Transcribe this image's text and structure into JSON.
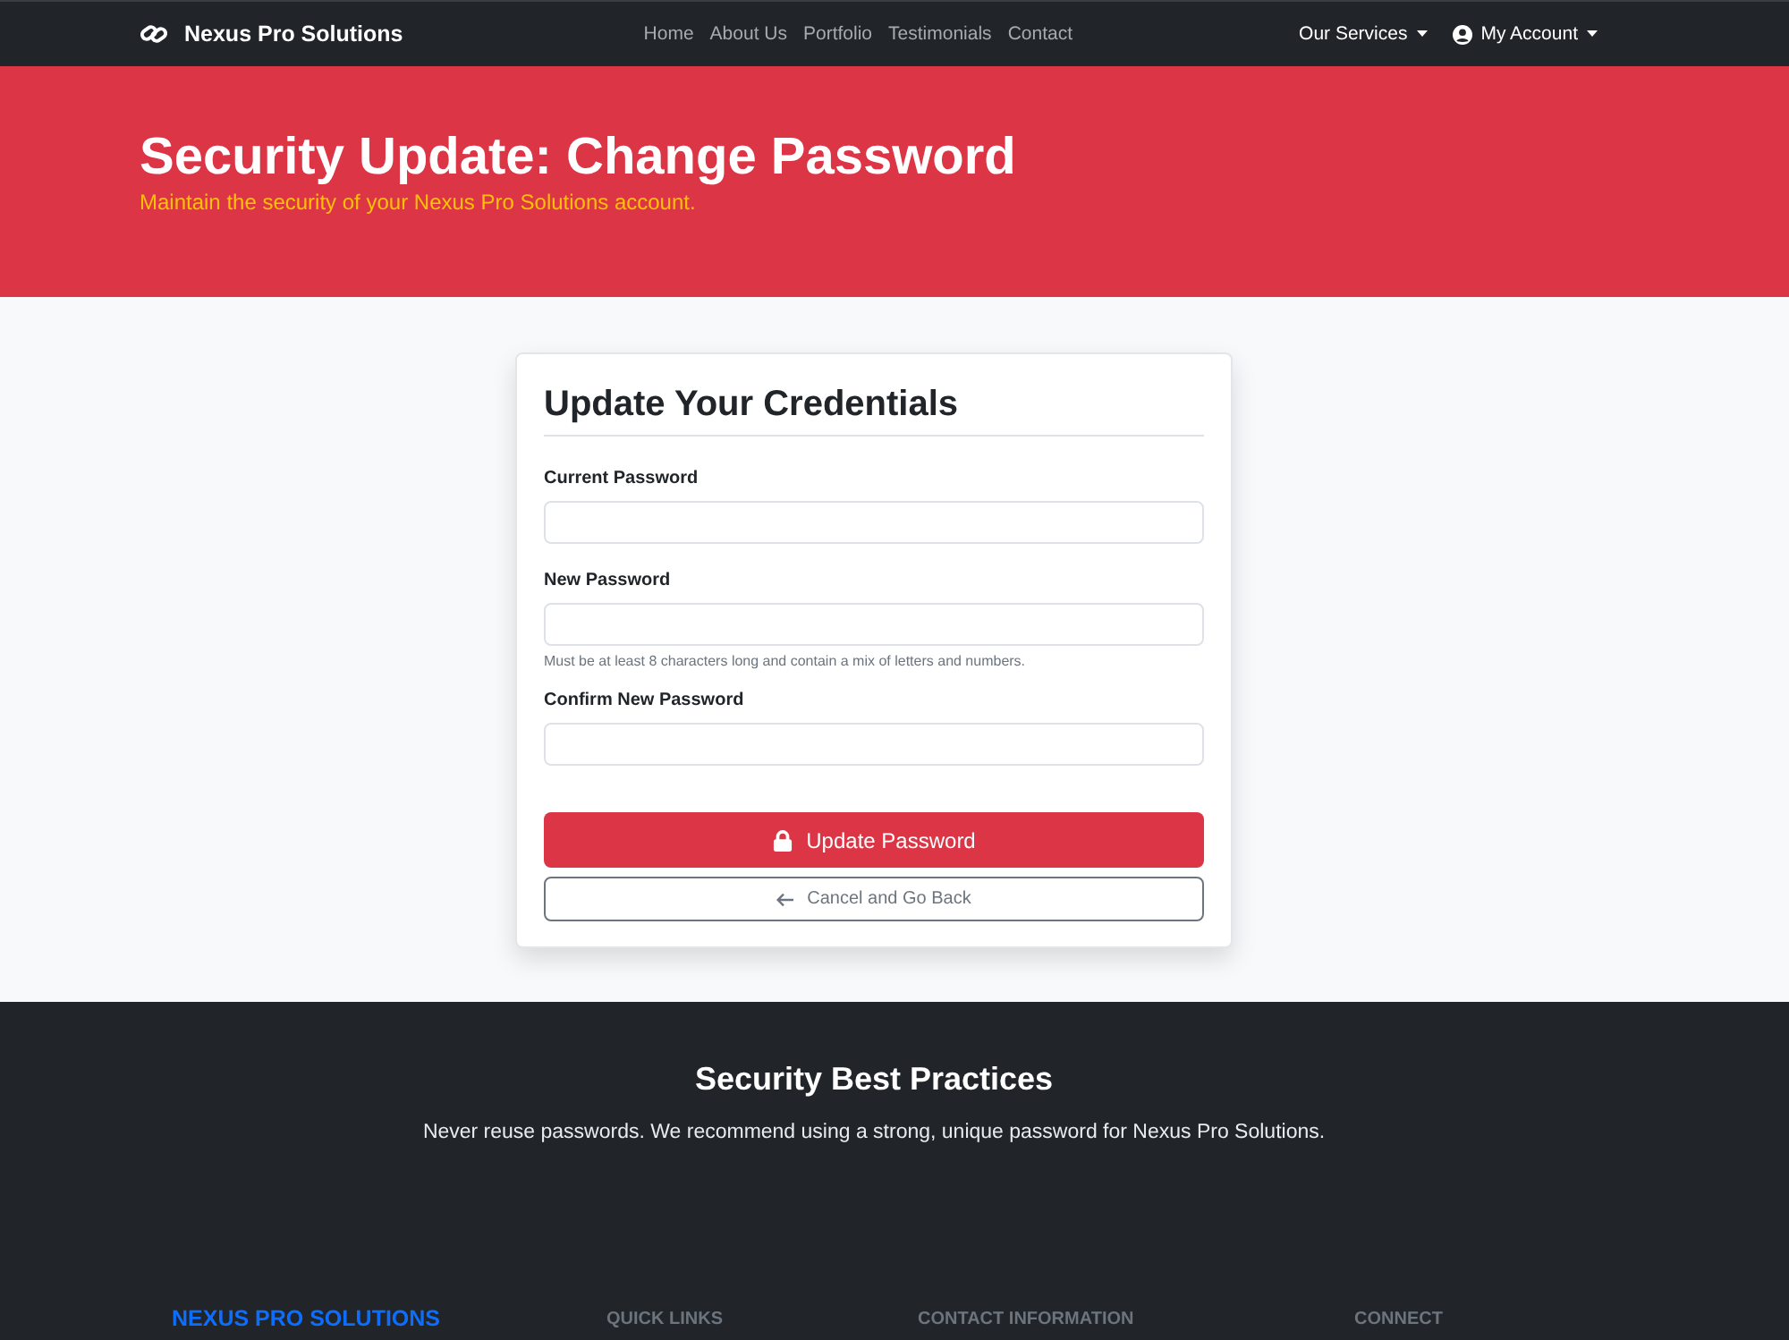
{
  "navbar": {
    "brand": "Nexus Pro Solutions",
    "links": [
      {
        "label": "Home"
      },
      {
        "label": "About Us"
      },
      {
        "label": "Portfolio"
      },
      {
        "label": "Testimonials"
      },
      {
        "label": "Contact"
      }
    ],
    "menus": [
      {
        "label": "Our Services",
        "kind": "plain"
      },
      {
        "label": "My Account",
        "kind": "account"
      }
    ]
  },
  "hero": {
    "title": "Security Update: Change Password",
    "subtitle": "Maintain the security of your Nexus Pro Solutions account."
  },
  "form": {
    "title": "Update Your Credentials",
    "fields": [
      {
        "label": "Current Password"
      },
      {
        "label": "New Password",
        "help": "Must be at least 8 characters long and contain a mix of letters and numbers."
      },
      {
        "label": "Confirm New Password"
      }
    ],
    "submit": "Update Password",
    "cancel": "Cancel and Go Back"
  },
  "notice": {
    "title": "Security Best Practices",
    "text": "Never reuse passwords. We recommend using a strong, unique password for Nexus Pro Solutions."
  },
  "footer": {
    "brand": "NEXUS PRO SOLUTIONS",
    "columns": [
      "QUICK LINKS",
      "CONTACT INFORMATION",
      "CONNECT"
    ]
  }
}
